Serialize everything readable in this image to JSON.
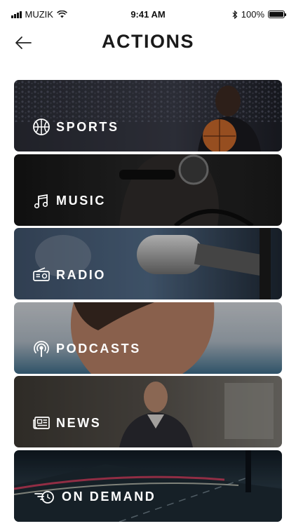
{
  "status_bar": {
    "carrier": "MUZIK",
    "time": "9:41 AM",
    "battery": "100%"
  },
  "header": {
    "title": "ACTIONS"
  },
  "cards": [
    {
      "label": "SPORTS",
      "icon": "basketball-icon"
    },
    {
      "label": "MUSIC",
      "icon": "music-note-icon"
    },
    {
      "label": "RADIO",
      "icon": "radio-icon"
    },
    {
      "label": "PODCASTS",
      "icon": "podcast-icon"
    },
    {
      "label": "NEWS",
      "icon": "newspaper-icon"
    },
    {
      "label": "ON DEMAND",
      "icon": "speed-clock-icon"
    }
  ]
}
